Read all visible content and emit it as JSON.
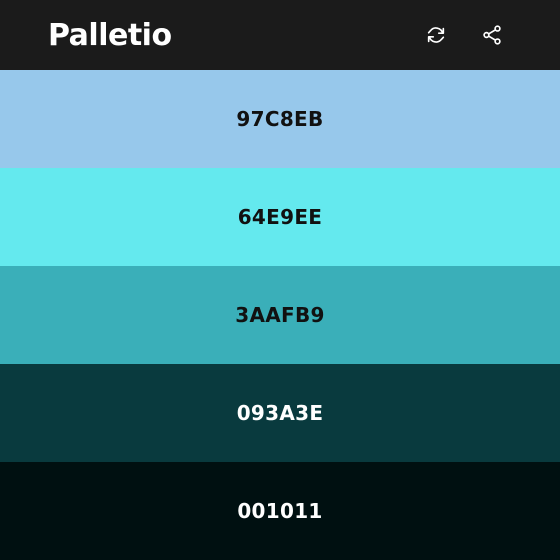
{
  "header": {
    "title": "Palletio",
    "icons": {
      "refresh": "refresh-icon",
      "share": "share-icon"
    },
    "background": "#1b1b1b",
    "title_color": "#ffffff"
  },
  "palette": {
    "swatches": [
      {
        "hex": "97C8EB",
        "color": "#97C8EB",
        "text_color": "#111111"
      },
      {
        "hex": "64E9EE",
        "color": "#64E9EE",
        "text_color": "#111111"
      },
      {
        "hex": "3AAFB9",
        "color": "#3AAFB9",
        "text_color": "#111111"
      },
      {
        "hex": "093A3E",
        "color": "#093A3E",
        "text_color": "#ffffff"
      },
      {
        "hex": "001011",
        "color": "#001011",
        "text_color": "#ffffff"
      }
    ]
  }
}
